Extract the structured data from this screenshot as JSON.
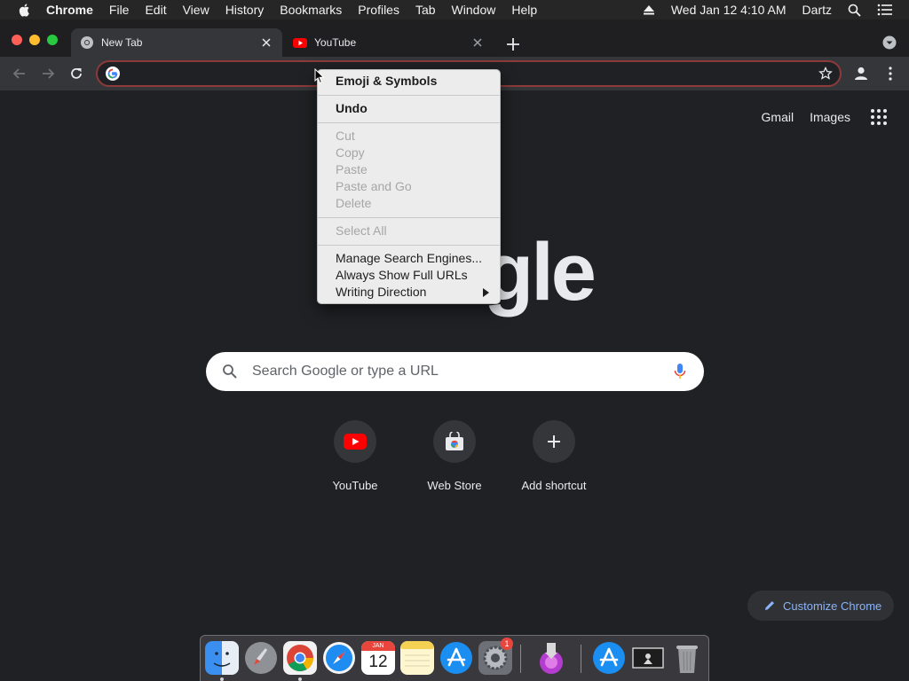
{
  "menubar": {
    "app_name": "Chrome",
    "items": [
      "File",
      "Edit",
      "View",
      "History",
      "Bookmarks",
      "Profiles",
      "Tab",
      "Window",
      "Help"
    ],
    "clock": "Wed Jan 12  4:10 AM",
    "user": "Dartz",
    "icons": [
      "apple-icon",
      "eject-icon",
      "spotlight-search-icon",
      "control-center-icon"
    ]
  },
  "tabs": [
    {
      "title": "New Tab",
      "active": true,
      "favicon": "chrome-icon"
    },
    {
      "title": "YouTube",
      "active": false,
      "favicon": "youtube-icon"
    }
  ],
  "toolbar": {
    "omnibox_value": "",
    "icons": [
      "back-icon",
      "forward-icon",
      "reload-icon",
      "google-g-icon",
      "bookmark-star-icon",
      "profile-icon",
      "menu-kebab-icon"
    ]
  },
  "header_links": {
    "gmail": "Gmail",
    "images": "Images"
  },
  "logo_visible_text": "gle",
  "search": {
    "placeholder": "Search Google or type a URL"
  },
  "shortcuts": [
    {
      "label": "YouTube",
      "icon": "youtube-icon"
    },
    {
      "label": "Web Store",
      "icon": "web-store-icon"
    },
    {
      "label": "Add shortcut",
      "icon": "plus-icon"
    }
  ],
  "customize": {
    "label": "Customize Chrome"
  },
  "context_menu": {
    "emoji": "Emoji & Symbols",
    "undo": "Undo",
    "cut": "Cut",
    "copy": "Copy",
    "paste": "Paste",
    "paste_and_go": "Paste and Go",
    "delete": "Delete",
    "select_all": "Select All",
    "manage_search": "Manage Search Engines...",
    "always_show_urls": "Always Show Full URLs",
    "writing_direction": "Writing Direction"
  },
  "dock": {
    "apps": [
      "Finder",
      "Launchpad",
      "Google Chrome",
      "Safari",
      "Calendar",
      "Notes",
      "App Store",
      "System Preferences",
      "Downloads",
      "App Store",
      "Screenshot",
      "Trash"
    ],
    "calendar_month": "JAN",
    "calendar_day": "12",
    "badge_count": "1"
  },
  "colors": {
    "page_bg": "#202124",
    "toolbar_bg": "#35363a",
    "link_blue": "#8ab4f8",
    "omnibox_border": "#8c3a3a"
  }
}
